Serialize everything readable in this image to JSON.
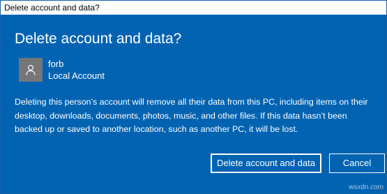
{
  "window": {
    "title": "Delete account and data?"
  },
  "dialog": {
    "heading": "Delete account and data?",
    "account": {
      "name": "forb",
      "type": "Local Account",
      "avatar_icon": "user-avatar-icon"
    },
    "message": "Deleting this person’s account will remove all their data from this PC, including items on their desktop, downloads, documents, photos, music, and other files. If this data hasn’t been backed up or saved to another location, such as another PC, it will be lost.",
    "buttons": {
      "delete_label": "Delete account and data",
      "cancel_label": "Cancel"
    }
  },
  "watermark": "wsxdn.com",
  "colors": {
    "background": "#0063b1",
    "avatar_bg": "#767676",
    "text": "#ffffff"
  }
}
